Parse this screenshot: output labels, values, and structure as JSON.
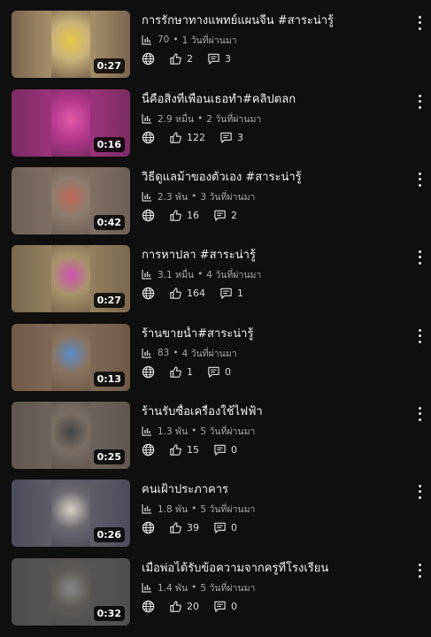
{
  "videos": [
    {
      "title": "การรักษาทางแพทย์แผนจีน #สาระน่ารู้",
      "views": "70",
      "age": "1 วันที่ผ่านมา",
      "likes": "2",
      "comments": "3",
      "duration": "0:27",
      "bg": "#7a6551",
      "center": "#c8b27a",
      "accent": "#e6c84a"
    },
    {
      "title": "นี้คือสิ่งที่เพื่อนเธอทำ#คลิปตลก",
      "views": "2.9 หมื่น",
      "age": "2 วันที่ผ่านมา",
      "likes": "122",
      "comments": "3",
      "duration": "0:16",
      "bg": "#7b2c63",
      "center": "#b53a8e",
      "accent": "#e35aa8"
    },
    {
      "title": "วิธีดูแลม้าของตัวเอง #สาระน่ารู้",
      "views": "2.3 พัน",
      "age": "3 วันที่ผ่านมา",
      "likes": "16",
      "comments": "2",
      "duration": "0:42",
      "bg": "#6e5f55",
      "center": "#8d7d70",
      "accent": "#c06a5a"
    },
    {
      "title": "การหาปลา #สาระน่ารู้",
      "views": "3.1 หมื่น",
      "age": "4 วันที่ผ่านมา",
      "likes": "164",
      "comments": "1",
      "duration": "0:27",
      "bg": "#7a6850",
      "center": "#a8946c",
      "accent": "#d050b0"
    },
    {
      "title": "ร้านขายน้ำ#สาระน่ารู้",
      "views": "83",
      "age": "4 วันที่ผ่านมา",
      "likes": "1",
      "comments": "0",
      "duration": "0:13",
      "bg": "#6e5a48",
      "center": "#8a7460",
      "accent": "#5a8cc8"
    },
    {
      "title": "ร้านรับซื้อเครื่องใช้ไฟฟ้า",
      "views": "1.3 พัน",
      "age": "5 วันที่ผ่านมา",
      "likes": "15",
      "comments": "0",
      "duration": "0:25",
      "bg": "#605650",
      "center": "#7a6e64",
      "accent": "#444444"
    },
    {
      "title": "คนเฝ้าประภาคาร",
      "views": "1.8 พัน",
      "age": "5 วันที่ผ่านมา",
      "likes": "39",
      "comments": "0",
      "duration": "0:26",
      "bg": "#4b4c5c",
      "center": "#6e6a70",
      "accent": "#d8d0c8"
    },
    {
      "title": "เมื่อพ่อได้รับข้อความจากครูที่โรงเรียน",
      "views": "1.4 พัน",
      "age": "5 วันที่ผ่านมา",
      "likes": "20",
      "comments": "0",
      "duration": "0:32",
      "bg": "#4e4e4e",
      "center": "#5e5a56",
      "accent": "#888888"
    }
  ],
  "icons": {
    "views": "bar-chart-icon",
    "visibility": "globe-icon",
    "likes": "thumbs-up-icon",
    "comments": "comment-icon",
    "menu": "more-vertical-icon"
  },
  "separator": "•"
}
